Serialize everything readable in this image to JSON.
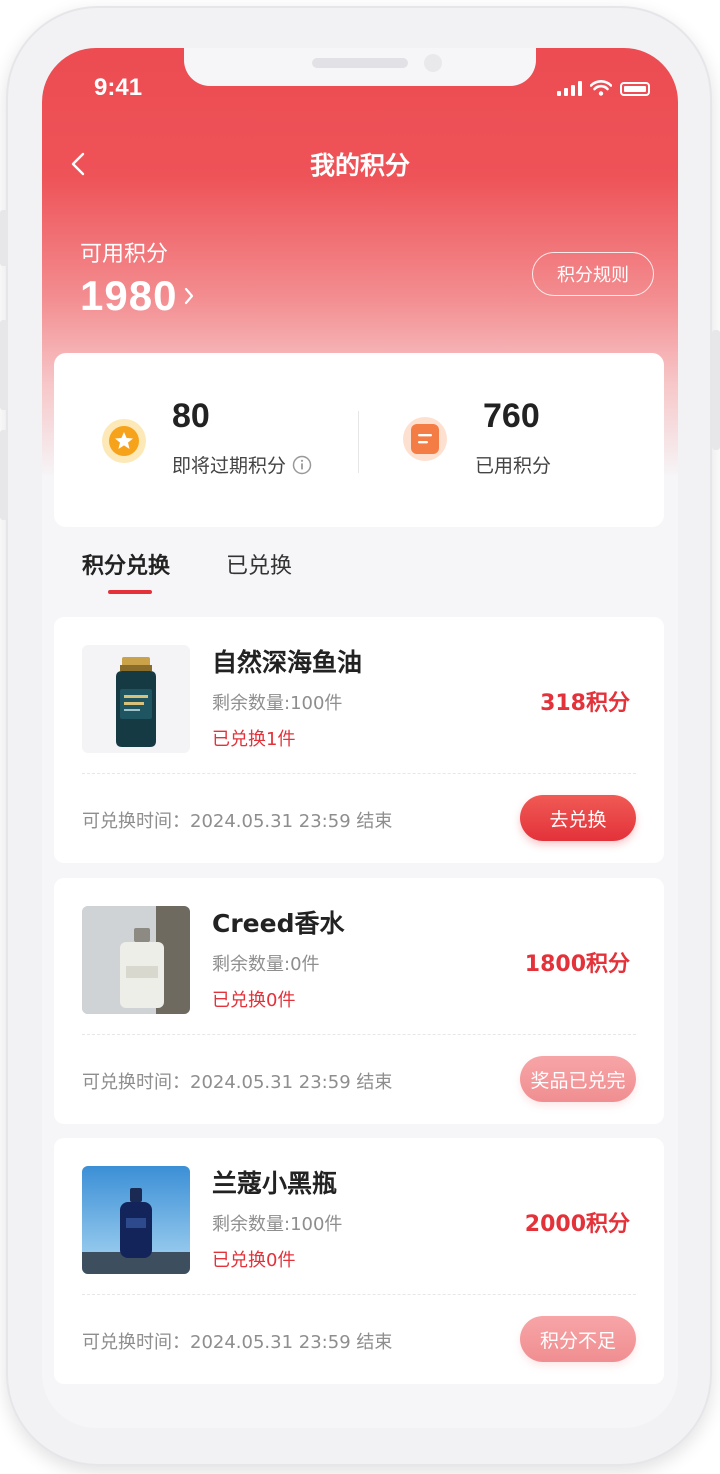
{
  "status_bar": {
    "time": "9:41"
  },
  "nav": {
    "title": "我的积分"
  },
  "points_header": {
    "label": "可用积分",
    "value": "1980",
    "rules_button": "积分规则"
  },
  "stats": [
    {
      "value": "80",
      "label": "即将过期积分",
      "icon": "star-coin-icon"
    },
    {
      "value": "760",
      "label": "已用积分",
      "icon": "document-icon"
    }
  ],
  "tabs": [
    {
      "label": "积分兑换",
      "active": true
    },
    {
      "label": "已兑换",
      "active": false
    }
  ],
  "products": [
    {
      "name": "自然深海鱼油",
      "remaining": "剩余数量:100件",
      "redeemed": "已兑换1件",
      "points": "318积分",
      "deadline": "可兑换时间：2024.05.31 23:59 结束",
      "action": "去兑换",
      "action_state": "enabled"
    },
    {
      "name": "Creed香水",
      "remaining": "剩余数量:0件",
      "redeemed": "已兑换0件",
      "points": "1800积分",
      "deadline": "可兑换时间：2024.05.31 23:59 结束",
      "action": "奖品已兑完",
      "action_state": "disabled"
    },
    {
      "name": "兰蔻小黑瓶",
      "remaining": "剩余数量:100件",
      "redeemed": "已兑换0件",
      "points": "2000积分",
      "deadline": "可兑换时间：2024.05.31 23:59 结束",
      "action": "积分不足",
      "action_state": "disabled"
    }
  ],
  "colors": {
    "primary_red": "#e3323a",
    "header_red": "#ec4c52",
    "disabled_button": "#f5a0a2",
    "background": "#f6f6f8"
  }
}
